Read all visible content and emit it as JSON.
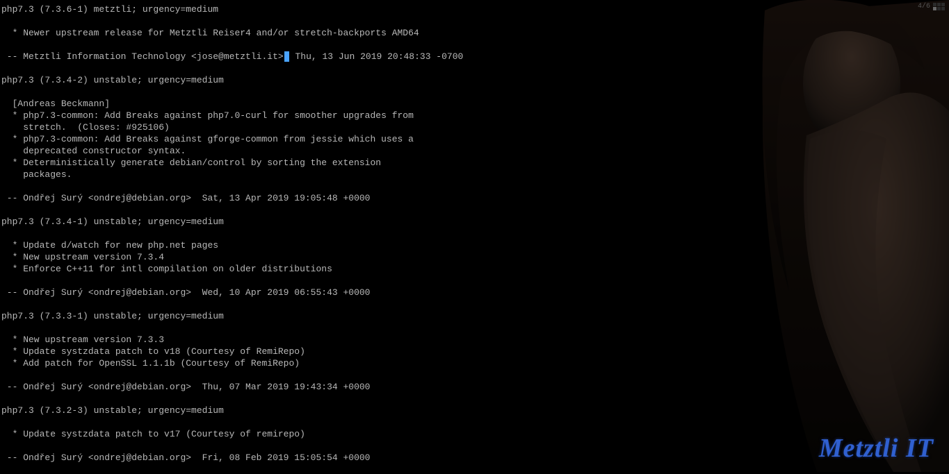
{
  "workspace": {
    "label": "4/6"
  },
  "watermark": "Metztli IT",
  "changelog": [
    "php7.3 (7.3.6-1) metztli; urgency=medium",
    "",
    "  * Newer upstream release for Metztli Reiser4 and/or stretch-backports AMD64",
    "",
    " -- Metztli Information Technology <jose@metztli.it>  Thu, 13 Jun 2019 20:48:33 -0700",
    "",
    "php7.3 (7.3.4-2) unstable; urgency=medium",
    "",
    "  [Andreas Beckmann]",
    "  * php7.3-common: Add Breaks against php7.0-curl for smoother upgrades from",
    "    stretch.  (Closes: #925106)",
    "  * php7.3-common: Add Breaks against gforge-common from jessie which uses a",
    "    deprecated constructor syntax.",
    "  * Deterministically generate debian/control by sorting the extension",
    "    packages.",
    "",
    " -- Ondřej Surý <ondrej@debian.org>  Sat, 13 Apr 2019 19:05:48 +0000",
    "",
    "php7.3 (7.3.4-1) unstable; urgency=medium",
    "",
    "  * Update d/watch for new php.net pages",
    "  * New upstream version 7.3.4",
    "  * Enforce C++11 for intl compilation on older distributions",
    "",
    " -- Ondřej Surý <ondrej@debian.org>  Wed, 10 Apr 2019 06:55:43 +0000",
    "",
    "php7.3 (7.3.3-1) unstable; urgency=medium",
    "",
    "  * New upstream version 7.3.3",
    "  * Update systzdata patch to v18 (Courtesy of RemiRepo)",
    "  * Add patch for OpenSSL 1.1.1b (Courtesy of RemiRepo)",
    "",
    " -- Ondřej Surý <ondrej@debian.org>  Thu, 07 Mar 2019 19:43:34 +0000",
    "",
    "php7.3 (7.3.2-3) unstable; urgency=medium",
    "",
    "  * Update systzdata patch to v17 (Courtesy of remirepo)",
    "",
    " -- Ondřej Surý <ondrej@debian.org>  Fri, 08 Feb 2019 15:05:54 +0000"
  ],
  "cursor_line_index": 4,
  "cursor_line_prefix": " -- Metztli Information Technology <jose@metztli.it>",
  "cursor_line_suffix": " Thu, 13 Jun 2019 20:48:33 -0700"
}
